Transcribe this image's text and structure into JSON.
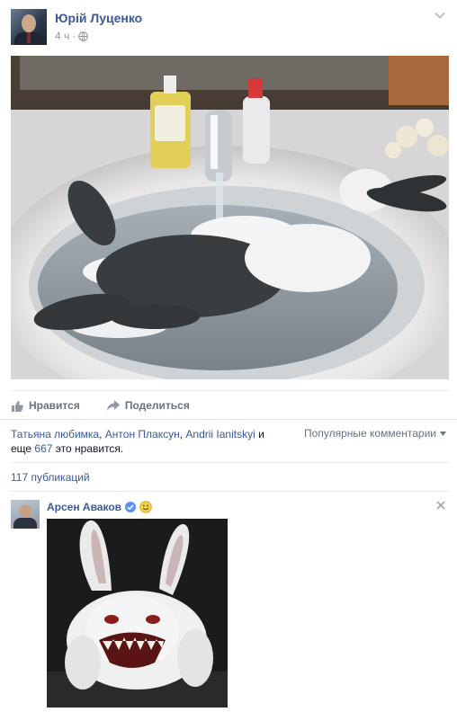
{
  "post": {
    "author": "Юрій Луценко",
    "time": "4 ч",
    "separator": "·",
    "privacy_icon": "globe-icon",
    "menu_icon": "chevron-down-icon"
  },
  "actions": {
    "like": "Нравится",
    "share": "Поделиться"
  },
  "likes": {
    "names": [
      "Татьяна любимка",
      "Антон Плаксун",
      "Andrii Ianitskyi"
    ],
    "sep": ", ",
    "and": " и",
    "more_prefix": "еще ",
    "more_count": "667",
    "suffix": " это нравится."
  },
  "sort": {
    "label": "Популярные комментарии",
    "icon": "caret-down-icon"
  },
  "shares": "117 публикаций",
  "comment": {
    "author": "Арсен Аваков",
    "verified_icon": "verified-badge-icon",
    "emoji_icon": "smiley-emoji-icon",
    "close_icon": "close-icon"
  },
  "colors": {
    "link": "#3b5998",
    "muted": "#9197a3",
    "action": "#6a7180",
    "verified": "#5890ff",
    "emoji": "#f7d23e"
  }
}
